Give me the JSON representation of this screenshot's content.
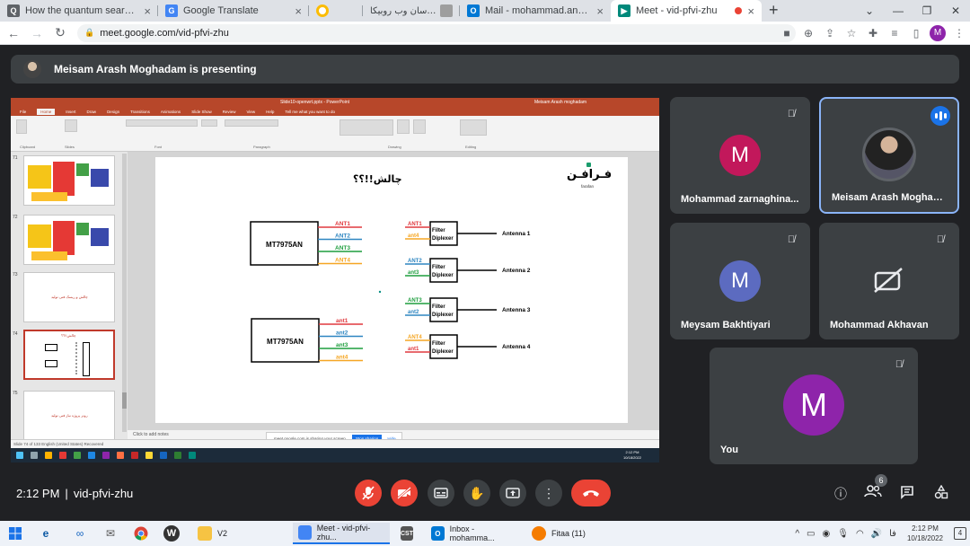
{
  "browser": {
    "tabs": [
      {
        "title": "How the quantum search algorit",
        "icon": "document-icon",
        "color": "#5f6368",
        "active": false
      },
      {
        "title": "Google Translate",
        "icon": "google-translate-icon",
        "color": "#4285f4",
        "active": false
      },
      {
        "title": "",
        "icon": "colorful-circle-icon",
        "color": "#fbbc04",
        "active": false
      },
      {
        "title": "پیام رسان وب روبیکا",
        "icon": "rubika-icon",
        "color": "#9e9e9e",
        "active": false
      },
      {
        "title": "Mail - mohammad.ansari@mci.ir",
        "icon": "outlook-icon",
        "color": "#0078d4",
        "active": false
      },
      {
        "title": "Meet - vid-pfvi-zhu",
        "icon": "google-meet-icon",
        "color": "#00897b",
        "active": true
      }
    ],
    "url": "meet.google.com/vid-pfvi-zhu",
    "profile_initial": "M"
  },
  "presenter_banner": {
    "text": "Meisam Arash Moghadam is presenting"
  },
  "shared_screen": {
    "ppt_filename": "Slide10-openwrt.pptx - PowerPoint",
    "ppt_user": "Meisam Arash moghadam",
    "ribbon_tabs": [
      "File",
      "Home",
      "Insert",
      "Draw",
      "Design",
      "Transitions",
      "Animations",
      "Slide Show",
      "Review",
      "View",
      "Help",
      "Tell me what you want to do"
    ],
    "thumb_numbers": [
      "71",
      "72",
      "73",
      "74",
      "75"
    ],
    "thumb_texts": [
      "",
      "",
      "چالش و ریسک فنی تولید",
      "چالش!!؟؟",
      "روتر پروژه نیاز فنی تولید"
    ],
    "notes_placeholder": "Click to add notes",
    "status_left": "Slide 74 of 133   English (United States)   Recovered",
    "share_text": "meet.google.com is sharing your screen.",
    "stop_sharing": "Stop sharing",
    "hide": "Hide",
    "win_clock_time": "2:12 PM",
    "win_clock_date": "10/18/2022",
    "slide": {
      "title": "چالش!!؟؟",
      "logo_text": "فـرافـن",
      "logo_sub": "farafan",
      "chip_label": "MT7975AN",
      "ports_top": [
        "ANT1",
        "ANT2",
        "ANT3",
        "ANT4"
      ],
      "ports_bottom": [
        "ant1",
        "ant2",
        "ant3",
        "ant4"
      ],
      "port_colors": [
        "#e0393e",
        "#2e86c1",
        "#1e9e3e",
        "#f5a623"
      ],
      "filter_label": "Filter\nDiplexer",
      "filters": [
        {
          "inputs": [
            "ANT1",
            "ant4"
          ],
          "antenna": "Antenna 1"
        },
        {
          "inputs": [
            "ANT2",
            "ant3"
          ],
          "antenna": "Antenna 2"
        },
        {
          "inputs": [
            "ANT3",
            "ant2"
          ],
          "antenna": "Antenna 3"
        },
        {
          "inputs": [
            "ANT4",
            "ant1"
          ],
          "antenna": "Antenna 4"
        }
      ]
    }
  },
  "participants": [
    {
      "name": "Mohammad zarnaghina...",
      "initial": "M",
      "avatar_color": "#c2185b",
      "muted": true,
      "speaking": false,
      "video_off": false
    },
    {
      "name": "Meisam Arash Moghada...",
      "initial": "",
      "avatar_color": "#1a1a1a",
      "muted": false,
      "speaking": true,
      "video_off": false
    },
    {
      "name": "Meysam Bakhtiyari",
      "initial": "M",
      "avatar_color": "#5c6bc0",
      "muted": true,
      "speaking": false,
      "video_off": false
    },
    {
      "name": "Mohammad Akhavan",
      "initial": "",
      "avatar_color": "",
      "muted": true,
      "speaking": false,
      "video_off": true
    },
    {
      "name": "You",
      "initial": "M",
      "avatar_color": "#8e24aa",
      "muted": true,
      "speaking": false,
      "video_off": false
    }
  ],
  "meeting": {
    "time": "2:12 PM",
    "separator": "|",
    "code": "vid-pfvi-zhu",
    "participant_count": "6"
  },
  "taskbar": {
    "pinned": [
      {
        "label": "V2",
        "icon": "folder-icon",
        "color": "#f6c343"
      },
      {
        "label": "Meet - vid-pfvi-zhu...",
        "icon": "chrome-icon",
        "color": "#4285f4",
        "active": true
      },
      {
        "label": "",
        "icon": "cst-icon",
        "color": "#555555"
      },
      {
        "label": "Inbox - mohamma...",
        "icon": "outlook-icon",
        "color": "#0078d4"
      },
      {
        "label": "Fitaa (11)",
        "icon": "fitaa-icon",
        "color": "#f57c00"
      }
    ],
    "clock_time": "2:12 PM",
    "clock_date": "10/18/2022",
    "language": "فا",
    "notification_count": "4"
  }
}
